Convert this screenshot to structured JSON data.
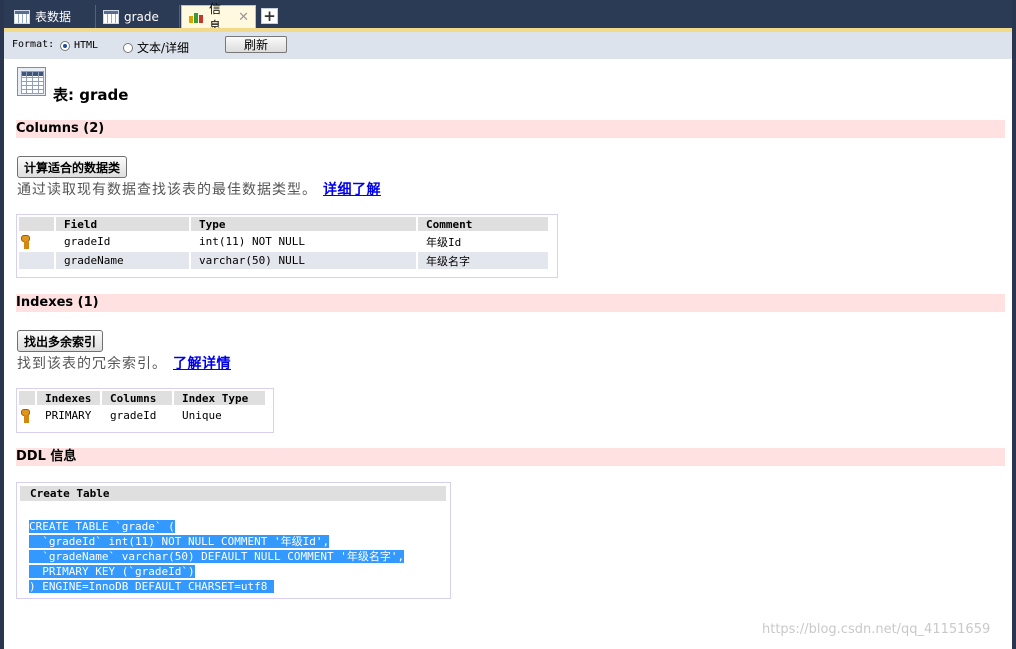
{
  "tabs": [
    {
      "label": "表数据",
      "active": false
    },
    {
      "label": "grade",
      "active": false
    },
    {
      "label": "信息",
      "active": true
    }
  ],
  "toolbar": {
    "format_label": "Format:",
    "radio_html": "HTML",
    "radio_text": "文本/详细",
    "selected": "HTML",
    "refresh_label": "刷新"
  },
  "page": {
    "title": "表: grade"
  },
  "columns_section": {
    "heading": "Columns (2)",
    "button_label": "计算适合的数据类",
    "description": "通过读取现有数据查找该表的最佳数据类型。",
    "link_text": "详细了解",
    "headers": [
      "Field",
      "Type",
      "Comment"
    ],
    "rows": [
      {
        "key": true,
        "field": "gradeId",
        "type": "int(11) NOT NULL",
        "comment": "年级Id"
      },
      {
        "key": false,
        "field": "gradeName",
        "type": "varchar(50) NULL",
        "comment": "年级名字"
      }
    ]
  },
  "indexes_section": {
    "heading": "Indexes (1)",
    "button_label": "找出多余索引",
    "description": "找到该表的冗余索引。",
    "link_text": "了解详情",
    "headers": [
      "Indexes",
      "Columns",
      "Index Type"
    ],
    "rows": [
      {
        "key": true,
        "index": "PRIMARY",
        "columns": "gradeId",
        "index_type": "Unique"
      }
    ]
  },
  "ddl_section": {
    "heading": "DDL 信息",
    "header": "Create Table",
    "lines": [
      "CREATE TABLE `grade` (",
      "  `gradeId` int(11) NOT NULL COMMENT '年级Id',",
      "  `gradeName` varchar(50) DEFAULT NULL COMMENT '年级名字',",
      "  PRIMARY KEY (`gradeId`)",
      ") ENGINE=InnoDB DEFAULT CHARSET=utf8 "
    ]
  },
  "watermark": "https://blog.csdn.net/qq_41151659",
  "colors": {
    "tab_bar": "#2b3a55",
    "section_bg": "#ffe1e1",
    "selection": "#3399ff",
    "link": "#0000ee"
  }
}
